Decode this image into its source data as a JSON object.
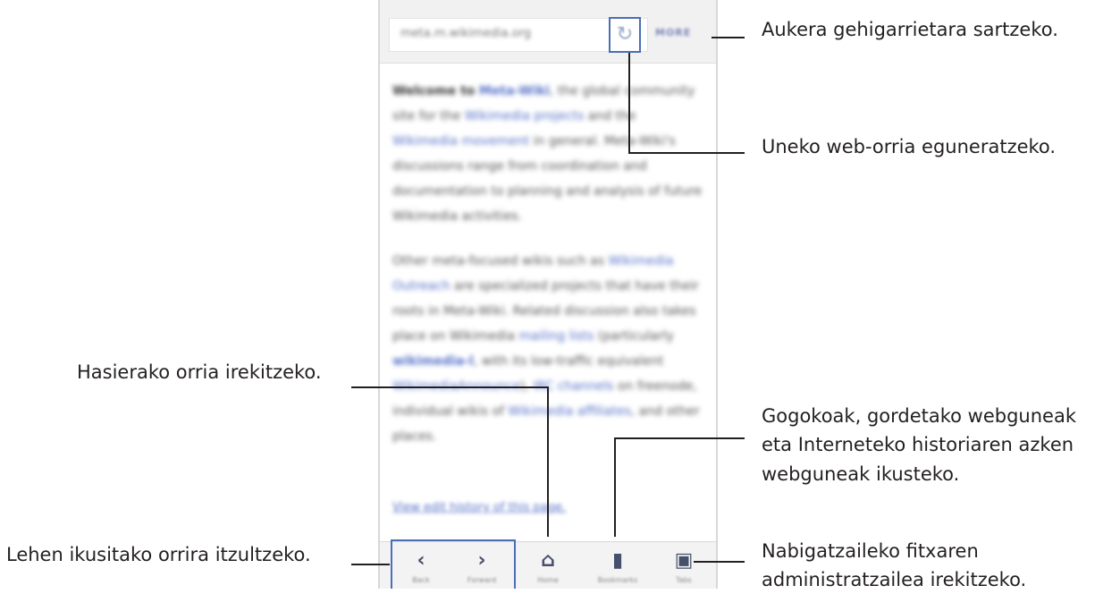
{
  "browser": {
    "url": "meta.m.wikimedia.org",
    "more_label": "MORE",
    "refresh_glyph": "↻",
    "content": {
      "p1_lead": "Welcome to",
      "p1_link": "Meta-Wiki",
      "p1_rest": ", the global community site for the",
      "p1_link2": "Wikimedia projects",
      "p1_mid": "and the",
      "p1_link3": "Wikimedia movement",
      "p1_tail": "in general. Meta-Wiki's discussions range from coordination and documentation to planning and analysis of future Wikimedia activities.",
      "p2_lead": "Other meta-focused wikis such as",
      "p2_link": "Wikimedia Outreach",
      "p2_mid": "are specialized projects that have their roots in Meta-Wiki. Related discussion also takes place on Wikimedia",
      "p2_link2": "mailing lists",
      "p2_mid2": "(particularly",
      "p2_bold": "wikimedia-l",
      "p2_mid3": ", with its low-traffic equivalent",
      "p2_link3": "WikimediaAnnounce",
      "p2_mid4": "),",
      "p2_link4": "IRC channels",
      "p2_mid5": "on freenode, individual wikis of",
      "p2_link5": "Wikimedia affiliates",
      "p2_tail": ", and other places."
    },
    "history_link": "View edit history of this page.",
    "nav": [
      {
        "glyph": "‹",
        "label": "Back"
      },
      {
        "glyph": "›",
        "label": "Forward"
      },
      {
        "glyph": "⌂",
        "label": "Home"
      },
      {
        "glyph": "▮",
        "label": "Bookmarks"
      },
      {
        "glyph": "▣",
        "label": "Tabs"
      }
    ]
  },
  "callouts": {
    "more": "Aukera gehigarrietara sartzeko.",
    "refresh": "Uneko web-orria eguneratzeko.",
    "bookmarks_line1": "Gogokoak, gordetako webguneak",
    "bookmarks_line2": "eta Interneteko historiaren azken",
    "bookmarks_line3": "webguneak ikusteko.",
    "home": "Hasierako orria irekitzeko.",
    "backfwd": "Lehen ikusitako orrira itzultzeko.",
    "tabs_line1": "Nabigatzaileko fitxaren",
    "tabs_line2": "administratzailea irekitzeko."
  },
  "colors": {
    "highlight": "#4a6fb3",
    "text": "#231f20",
    "link": "#5470c6"
  }
}
